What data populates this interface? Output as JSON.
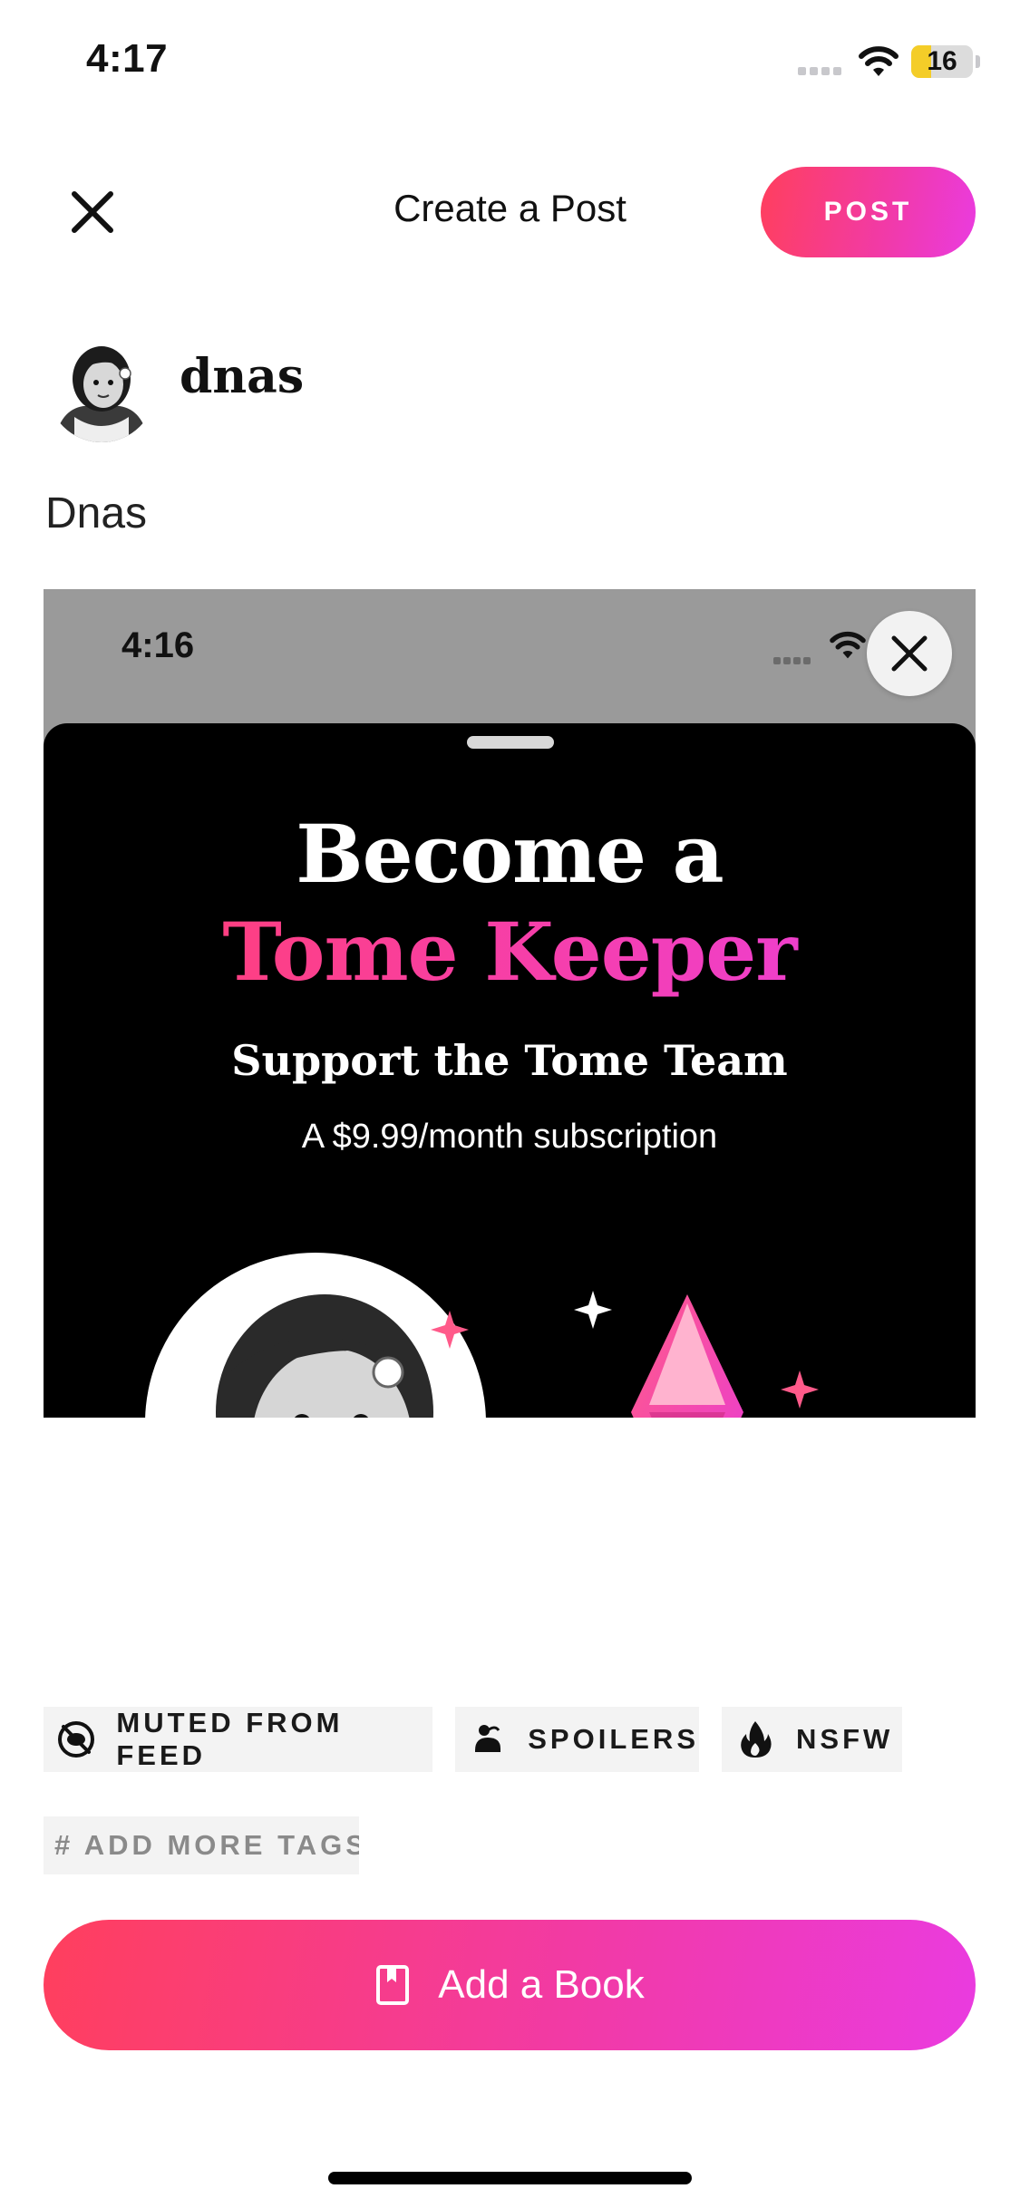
{
  "status_bar": {
    "time": "4:17",
    "battery": "16"
  },
  "header": {
    "title": "Create a Post",
    "post_label": "POST"
  },
  "author": {
    "name": "dnas"
  },
  "post": {
    "text": "Dnas"
  },
  "embedded_screenshot": {
    "status_time": "4:16",
    "promo": {
      "line1": "Become a",
      "line2": "Tome Keeper",
      "line3": "Support the Tome Team",
      "line4": "A $9.99/month subscription"
    }
  },
  "tags": [
    {
      "label": "MUTED FROM FEED",
      "icon": "muted-eye-icon"
    },
    {
      "label": "SPOILERS",
      "icon": "spoiler-icon"
    },
    {
      "label": "NSFW",
      "icon": "flame-icon"
    }
  ],
  "add_tags_label": "# ADD MORE TAGS",
  "add_book_label": "Add a Book",
  "colors": {
    "accent_start": "#ff3f5d",
    "accent_end": "#ea3be0",
    "battery_fill": "#f4cd28",
    "tag_bg": "#f3f3f3"
  }
}
